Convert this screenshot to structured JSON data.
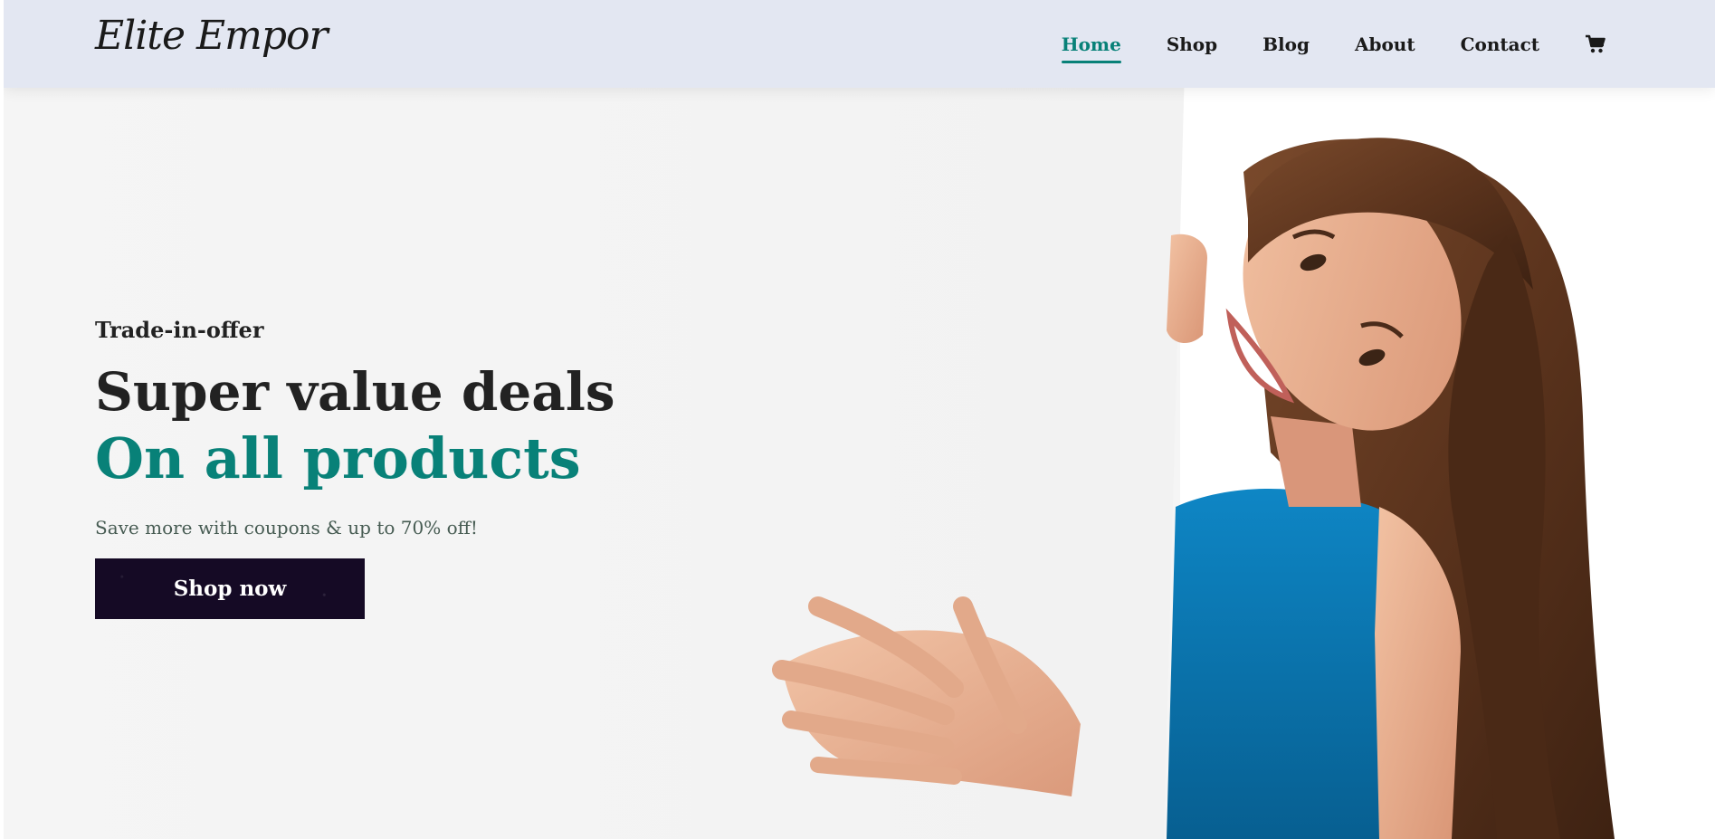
{
  "header": {
    "logo_text": "Elite Empor",
    "nav": [
      {
        "label": "Home",
        "active": true
      },
      {
        "label": "Shop",
        "active": false
      },
      {
        "label": "Blog",
        "active": false
      },
      {
        "label": "About",
        "active": false
      },
      {
        "label": "Contact",
        "active": false
      }
    ],
    "cart_icon": "shopping-cart-icon"
  },
  "hero": {
    "eyebrow": "Trade-in-offer",
    "headline": "Super value deals",
    "headline_accent": "On all products",
    "subtext": "Save more with coupons & up to 70% off!",
    "cta_label": "Shop now"
  },
  "colors": {
    "accent": "#088178",
    "header_bg": "#e3e7f2",
    "hero_bg": "#f5f5f5",
    "button_bg": "#150a25",
    "dress": "#0a76b3"
  }
}
